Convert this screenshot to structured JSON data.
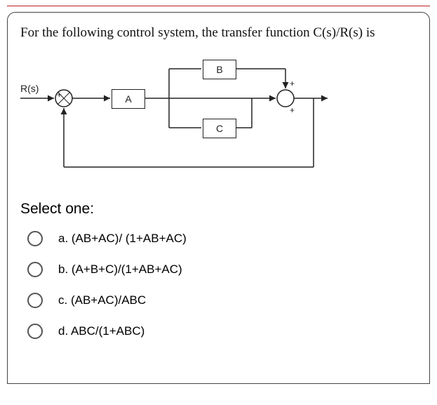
{
  "question": "For the following control system, the transfer function C(s)/R(s) is",
  "diagram": {
    "input_label": "R(s)",
    "blocks": {
      "A": "A",
      "B": "B",
      "C": "C"
    },
    "summing_signs": {
      "sum1": "+",
      "sum2_top": "+",
      "sum2_bot": "+"
    }
  },
  "select_label": "Select one:",
  "options": [
    {
      "key": "a",
      "text": "a. (AB+AC)/ (1+AB+AC)"
    },
    {
      "key": "b",
      "text": "b. (A+B+C)/(1+AB+AC)"
    },
    {
      "key": "c",
      "text": "c. (AB+AC)/ABC"
    },
    {
      "key": "d",
      "text": "d. ABC/(1+ABC)"
    }
  ]
}
